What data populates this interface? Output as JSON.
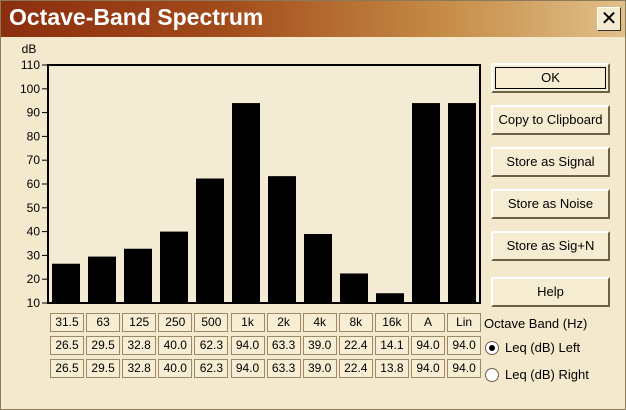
{
  "window": {
    "title": "Octave-Band Spectrum",
    "close_glyph": "✕"
  },
  "chart_data": {
    "type": "bar",
    "ylabel": "dB",
    "ylim": [
      10,
      110
    ],
    "yticks": [
      10,
      20,
      30,
      40,
      50,
      60,
      70,
      80,
      90,
      100,
      110
    ],
    "categories": [
      "31.5",
      "63",
      "125",
      "250",
      "500",
      "1k",
      "2k",
      "4k",
      "8k",
      "16k",
      "A",
      "Lin"
    ],
    "values": [
      26.5,
      29.5,
      32.8,
      40.0,
      62.3,
      94.0,
      63.3,
      39.0,
      22.4,
      14.1,
      94.0,
      94.0
    ],
    "grid": false,
    "colors": {
      "bar": "#000000",
      "plot_bg": "#f4ebd4",
      "frame": "#000000"
    }
  },
  "table": {
    "bands": [
      "31.5",
      "63",
      "125",
      "250",
      "500",
      "1k",
      "2k",
      "4k",
      "8k",
      "16k",
      "A",
      "Lin"
    ],
    "left": [
      "26.5",
      "29.5",
      "32.8",
      "40.0",
      "62.3",
      "94.0",
      "63.3",
      "39.0",
      "22.4",
      "14.1",
      "94.0",
      "94.0"
    ],
    "right": [
      "26.5",
      "29.5",
      "32.8",
      "40.0",
      "62.3",
      "94.0",
      "63.3",
      "39.0",
      "22.4",
      "13.8",
      "94.0",
      "94.0"
    ]
  },
  "buttons": {
    "ok": "OK",
    "copy": "Copy to Clipboard",
    "store_signal": "Store as Signal",
    "store_noise": "Store as Noise",
    "store_sign": "Store as Sig+N",
    "help": "Help"
  },
  "side": {
    "band_label": "Octave Band (Hz)",
    "leq_left": "Leq (dB) Left",
    "leq_right": "Leq (dB) Right",
    "selected": "left"
  }
}
